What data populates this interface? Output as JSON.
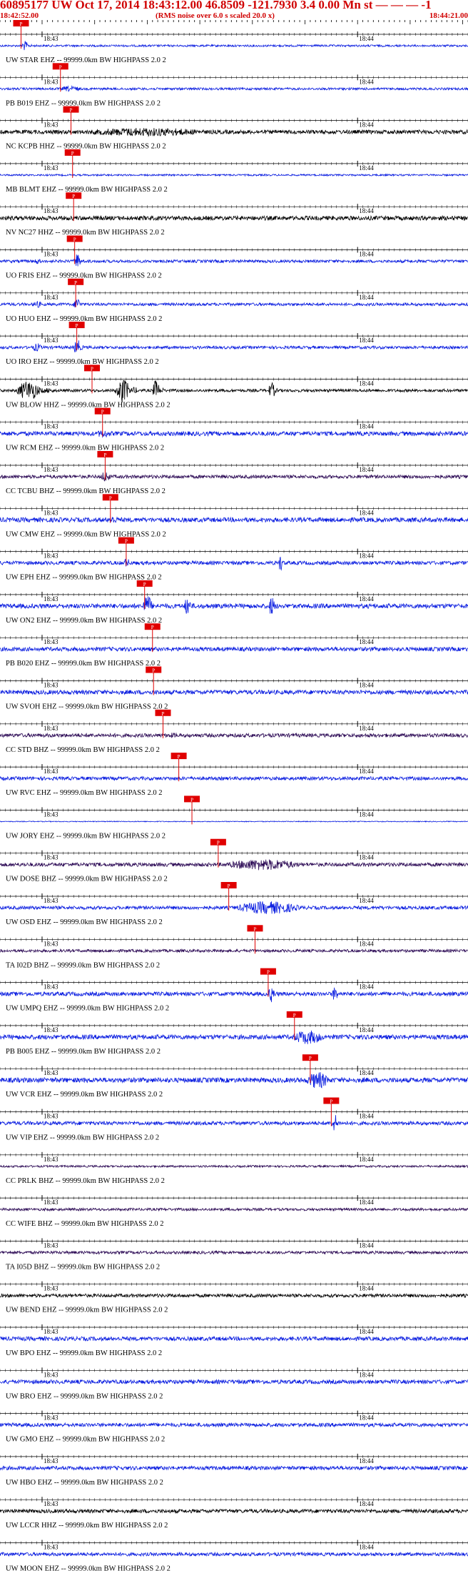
{
  "header": {
    "title": "60895177 UW Oct 17, 2014 18:43:12.00   46.8509 -121.7930  3.4 0.00 Mn st — — — -1",
    "start_time": "18:42:52.00",
    "rms_note": "(RMS noise over 6.0 s scaled 20.0 x)",
    "end_time": "18:44:21.00"
  },
  "colors": {
    "header": "#d00000",
    "blue": "#0a1de0",
    "black": "#000000",
    "purple": "#2c0a55",
    "pick": "#e00000",
    "grid": "#000000"
  },
  "chart_data": {
    "type": "line",
    "title": "60895177 UW Oct 17, 2014 18:43:12.00   46.8509 -121.7930  3.4 0.00 Mn st — — — -1",
    "subtitle": "(RMS noise over 6.0 s scaled 20.0 x)",
    "x_range": [
      "18:42:52.00",
      "18:44:21.00"
    ],
    "x_range_seconds": [
      0,
      89
    ],
    "tick_labels": [
      "18:43",
      "18:44"
    ],
    "tick_label_seconds": [
      8,
      68
    ],
    "pick_label": "P",
    "series": [
      {
        "label": "UW STAR EHZ -- 99999.0km BW  HIGHPASS  2.0  2",
        "color": "blue",
        "amp": 0.7,
        "pick": 4.0,
        "burst": [
          [
            4,
            6,
            3.5
          ]
        ]
      },
      {
        "label": "PB B019 EHZ -- 99999.0km BW  HIGHPASS  2.0  2",
        "color": "blue",
        "amp": 0.8,
        "pick": 11.5,
        "burst": [
          [
            11,
            18,
            2.0
          ]
        ]
      },
      {
        "label": "NC KCPB HHZ -- 99999.0km BW  HIGHPASS  2.0  2",
        "color": "black",
        "amp": 1.4,
        "pick": 13.5,
        "burst": [
          [
            13,
            55,
            3.0
          ]
        ]
      },
      {
        "label": "MB BLMT EHZ -- 99999.0km BW  HIGHPASS  2.0  2",
        "color": "blue",
        "amp": 0.6,
        "pick": 13.8,
        "burst": []
      },
      {
        "label": "NV NC27 HHZ -- 99999.0km BW  HIGHPASS  2.0  2",
        "color": "black",
        "amp": 1.5,
        "pick": 14.0,
        "burst": []
      },
      {
        "label": "UO FRIS EHZ -- 99999.0km BW  HIGHPASS  2.0  2",
        "color": "blue",
        "amp": 1.0,
        "pick": 14.2,
        "burst": [
          [
            14,
            16,
            5.5
          ],
          [
            6,
            9,
            2.0
          ]
        ]
      },
      {
        "label": "UO HUO EHZ -- 99999.0km BW  HIGHPASS  2.0  2",
        "color": "blue",
        "amp": 1.0,
        "pick": 14.4,
        "burst": [
          [
            14,
            16,
            5.0
          ],
          [
            6,
            9,
            2.5
          ]
        ]
      },
      {
        "label": "UO IRO EHZ -- 99999.0km BW  HIGHPASS  2.0  2",
        "color": "blue",
        "amp": 1.0,
        "pick": 14.6,
        "burst": [
          [
            14,
            16,
            6.0
          ],
          [
            6,
            9,
            3.0
          ]
        ]
      },
      {
        "label": "UW BLOW HHZ -- 99999.0km BW  HIGHPASS  2.0  2",
        "color": "black",
        "amp": 1.0,
        "pick": 17.5,
        "burst": [
          [
            3,
            10,
            7.0
          ],
          [
            22,
            26,
            9.0
          ],
          [
            29,
            31,
            8.0
          ],
          [
            51,
            53,
            6.0
          ]
        ]
      },
      {
        "label": "UW RCM EHZ -- 99999.0km BW  HIGHPASS  2.0  2",
        "color": "blue",
        "amp": 1.5,
        "pick": 19.5,
        "burst": [
          [
            18,
            23,
            3.0
          ]
        ]
      },
      {
        "label": "CC TCBU BHZ -- 99999.0km BW  HIGHPASS  2.0  2",
        "color": "purple",
        "amp": 1.2,
        "pick": 20.0,
        "burst": [
          [
            19,
            22,
            4.0
          ]
        ]
      },
      {
        "label": "UW CMW EHZ -- 99999.0km BW  HIGHPASS  2.0  2",
        "color": "blue",
        "amp": 1.6,
        "pick": 21.0,
        "burst": [
          [
            20,
            24,
            3.0
          ]
        ]
      },
      {
        "label": "UW EPH EHZ -- 99999.0km BW  HIGHPASS  2.0  2",
        "color": "blue",
        "amp": 1.3,
        "pick": 24.0,
        "burst": [
          [
            23,
            26,
            3.0
          ],
          [
            53,
            54,
            7.0
          ]
        ]
      },
      {
        "label": "UW ON2 EHZ -- 99999.0km BW  HIGHPASS  2.0  2",
        "color": "blue",
        "amp": 1.6,
        "pick": 27.5,
        "burst": [
          [
            27,
            30,
            7.5
          ],
          [
            35,
            37,
            7.0
          ],
          [
            51,
            53,
            7.0
          ]
        ]
      },
      {
        "label": "PB B020 EHZ -- 99999.0km BW  HIGHPASS  2.0  2",
        "color": "blue",
        "amp": 1.4,
        "pick": 29.0,
        "burst": []
      },
      {
        "label": "UW SVOH EHZ -- 99999.0km BW  HIGHPASS  2.0  2",
        "color": "blue",
        "amp": 1.5,
        "pick": 29.2,
        "burst": []
      },
      {
        "label": "CC STD BHZ -- 99999.0km BW  HIGHPASS  2.0  2",
        "color": "purple",
        "amp": 1.3,
        "pick": 31.0,
        "burst": [
          [
            30,
            38,
            1.8
          ]
        ]
      },
      {
        "label": "UW RVC EHZ -- 99999.0km BW  HIGHPASS  2.0  2",
        "color": "blue",
        "amp": 1.2,
        "pick": 34.0,
        "burst": []
      },
      {
        "label": "UW JORY EHZ -- 99999.0km BW  HIGHPASS  2.0  2",
        "color": "blue",
        "amp": 0.3,
        "pick": 36.5,
        "burst": []
      },
      {
        "label": "UW DOSE BHZ -- 99999.0km BW  HIGHPASS  2.0  2",
        "color": "purple",
        "amp": 1.3,
        "pick": 41.5,
        "burst": [
          [
            42,
            65,
            4.0
          ]
        ]
      },
      {
        "label": "UW OSD EHZ -- 99999.0km BW  HIGHPASS  2.0  2",
        "color": "blue",
        "amp": 1.2,
        "pick": 43.5,
        "burst": [
          [
            44,
            64,
            4.5
          ]
        ]
      },
      {
        "label": "TA I02D BHZ -- 99999.0km BW  HIGHPASS  2.0  2",
        "color": "purple",
        "amp": 1.0,
        "pick": 48.5,
        "burst": []
      },
      {
        "label": "UW UMPQ EHZ -- 99999.0km BW  HIGHPASS  2.0  2",
        "color": "blue",
        "amp": 1.4,
        "pick": 51.0,
        "burst": [
          [
            51,
            53,
            6.0
          ],
          [
            63,
            65,
            5.0
          ]
        ]
      },
      {
        "label": "PB B005 EHZ -- 99999.0km BW  HIGHPASS  2.0  2",
        "color": "blue",
        "amp": 1.6,
        "pick": 56.0,
        "burst": [
          [
            55,
            65,
            5.0
          ]
        ]
      },
      {
        "label": "UW VCR EHZ -- 99999.0km BW  HIGHPASS  2.0  2",
        "color": "blue",
        "amp": 1.7,
        "pick": 59.0,
        "burst": [
          [
            58,
            65,
            6.0
          ]
        ]
      },
      {
        "label": "UW VIP EHZ -- 99999.0km BW  HIGHPASS  2.0  2",
        "color": "blue",
        "amp": 1.3,
        "pick": 63.0,
        "burst": [
          [
            63,
            65,
            6.0
          ]
        ]
      },
      {
        "label": "CC PRLK BHZ -- 99999.0km BW  HIGHPASS  2.0  2",
        "color": "purple",
        "amp": 0.7,
        "pick": null,
        "burst": []
      },
      {
        "label": "CC WIFE BHZ -- 99999.0km BW  HIGHPASS  2.0  2",
        "color": "purple",
        "amp": 0.9,
        "pick": null,
        "burst": []
      },
      {
        "label": "TA I05D BHZ -- 99999.0km BW  HIGHPASS  2.0  2",
        "color": "purple",
        "amp": 1.0,
        "pick": null,
        "burst": []
      },
      {
        "label": "UW BEND EHZ -- 99999.0km BW  HIGHPASS  2.0  2",
        "color": "black",
        "amp": 1.2,
        "pick": null,
        "burst": []
      },
      {
        "label": "UW BPO EHZ -- 99999.0km BW  HIGHPASS  2.0  2",
        "color": "blue",
        "amp": 1.4,
        "pick": null,
        "burst": []
      },
      {
        "label": "UW BRO EHZ -- 99999.0km BW  HIGHPASS  2.0  2",
        "color": "blue",
        "amp": 1.4,
        "pick": null,
        "burst": []
      },
      {
        "label": "UW GMO EHZ -- 99999.0km BW  HIGHPASS  2.0  2",
        "color": "blue",
        "amp": 1.3,
        "pick": null,
        "burst": []
      },
      {
        "label": "UW HBO EHZ -- 99999.0km BW  HIGHPASS  2.0  2",
        "color": "blue",
        "amp": 1.3,
        "pick": null,
        "burst": []
      },
      {
        "label": "UW LCCR HHZ -- 99999.0km BW  HIGHPASS  2.0  2",
        "color": "black",
        "amp": 1.3,
        "pick": null,
        "burst": []
      },
      {
        "label": "UW MOON EHZ -- 99999.0km BW  HIGHPASS  2.0  2",
        "color": "blue",
        "amp": 1.2,
        "pick": null,
        "burst": []
      }
    ]
  }
}
